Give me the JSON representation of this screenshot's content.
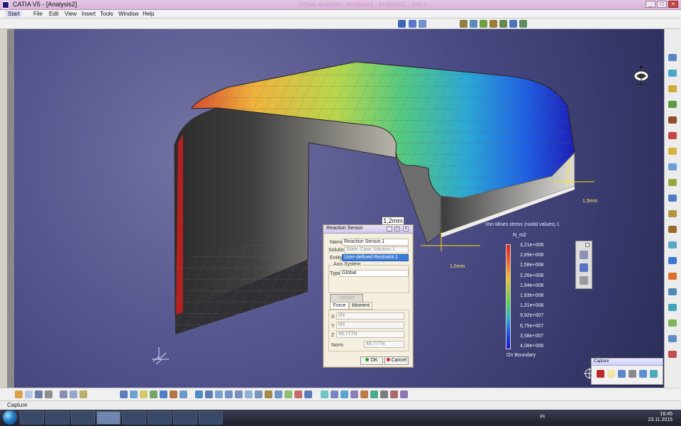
{
  "window": {
    "title": "CATIA V5 - [Analysis2]",
    "ghost_title": "Virtual analysis - Analysis2 / Analysis2 - 3ds-v"
  },
  "menu": {
    "items": [
      "Start",
      "File",
      "Edit",
      "View",
      "Insert",
      "Tools",
      "Window",
      "Help"
    ]
  },
  "viewport": {
    "dimension_label": "1,2mm",
    "dimension_tags": [
      "1,5mm",
      "1,5mm"
    ]
  },
  "legend": {
    "title": "Von Mises stress (nodal values).1",
    "unit": "N_m2",
    "values": [
      "3,21e+008",
      "2,89e+008",
      "2,58e+008",
      "2,26e+008",
      "1,94e+008",
      "1,63e+008",
      "1,31e+008",
      "9,92e+007",
      "6,75e+007",
      "3,58e+007",
      "4,08e+006"
    ],
    "footer": "On Boundary"
  },
  "dialog": {
    "title": "Reaction Sensor",
    "name_label": "Name",
    "name_value": "Reaction Sensor.1",
    "solution_label": "Solution",
    "solution_value": "Static Case Solution.1",
    "entity_label": "Entity",
    "entity_value": "User-defined Restraint.1",
    "axis_group_label": "Axis System",
    "type_label": "Type",
    "type_value": "Global",
    "update_button": "Update results",
    "force_tab": "Force",
    "moment_tab": "Moment",
    "x_label": "X",
    "x_value": "0N",
    "y_label": "Y",
    "y_value": "0N",
    "z_label": "Z",
    "z_value": "48,777N",
    "norm_label": "Norm",
    "norm_value": "48,777N",
    "ok_label": "OK",
    "cancel_label": "Cancel"
  },
  "capture": {
    "title": "Capture"
  },
  "status": {
    "text": "Capture"
  },
  "taskbar": {
    "lang": "FI",
    "time": "16:45",
    "date": "23.11.2015"
  }
}
